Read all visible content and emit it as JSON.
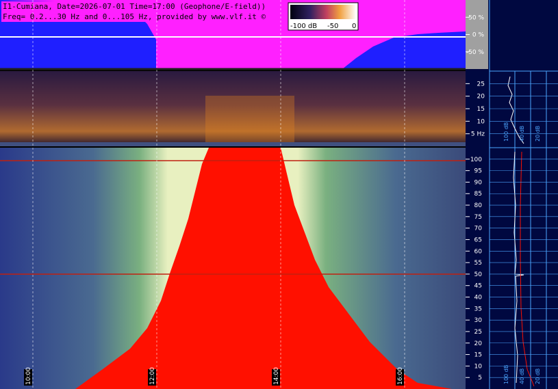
{
  "header": {
    "line1": "I1-Cumiana, Date=2026-07-01 Time=17:00 (Geophone/E-field))",
    "line2": "Freq= 0.2...30 Hz and 0...105 Hz, provided by www.vlf.it ©"
  },
  "colorbar": {
    "labels": [
      "-100 dB",
      "-50",
      "0"
    ]
  },
  "colors": {
    "magenta": "#ff20ff",
    "blue": "#1f1fff",
    "panel_bg": "#000840",
    "spectro_blue": "#2a3a8a",
    "spectro_green": "#6aa070",
    "red": "#ff1000",
    "hum_line": "#c02010",
    "amber": "#e08020",
    "grid": "#4da6ff"
  },
  "chart_data": [
    {
      "type": "area",
      "name": "amplitude",
      "y_ticks": [
        "50 %",
        "0 %",
        "-50 %"
      ],
      "y_values": [
        50,
        0,
        -50
      ],
      "ylim": [
        -100,
        100
      ]
    },
    {
      "type": "heatmap",
      "name": "low-frequency spectrogram",
      "y_ticks": [
        "25",
        "20",
        "15",
        "10",
        "5 Hz"
      ],
      "y_values": [
        25,
        20,
        15,
        10,
        5
      ],
      "ylim": [
        0,
        30
      ],
      "side_labels": [
        "100 dB",
        "40 dB",
        "20 dB"
      ]
    },
    {
      "type": "heatmap",
      "name": "high-frequency spectrogram",
      "y_ticks": [
        "100",
        "95",
        "90",
        "85",
        "80",
        "75",
        "70",
        "65",
        "60",
        "55",
        "50",
        "45",
        "40",
        "35",
        "30",
        "25",
        "20",
        "15",
        "10",
        "5"
      ],
      "y_values": [
        100,
        95,
        90,
        85,
        80,
        75,
        70,
        65,
        60,
        55,
        50,
        45,
        40,
        35,
        30,
        25,
        20,
        15,
        10,
        5
      ],
      "ylim": [
        0,
        105
      ],
      "x_ticks": [
        "10:00",
        "12:00",
        "14:00",
        "16:00"
      ],
      "side_labels": [
        "100 dB",
        "40 dB",
        "20 dB"
      ],
      "hum_lines_hz": [
        50,
        100
      ]
    }
  ]
}
